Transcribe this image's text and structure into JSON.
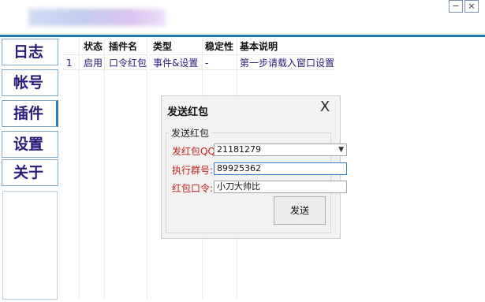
{
  "window": {
    "minimize_glyph": "−",
    "close_glyph": "×"
  },
  "sidebar": {
    "items": [
      {
        "label": "日志"
      },
      {
        "label": "帐号"
      },
      {
        "label": "插件"
      },
      {
        "label": "设置"
      },
      {
        "label": "关于"
      }
    ],
    "active_index": 2
  },
  "grid": {
    "columns": [
      "状态",
      "插件名",
      "类型",
      "稳定性",
      "基本说明"
    ],
    "rows": [
      {
        "index": "1",
        "status": "启用",
        "name": "口令红包",
        "type": "事件&设置",
        "stability": "-",
        "description": "第一步请载入窗口设置"
      }
    ]
  },
  "dialog": {
    "title": "发送红包",
    "close_glyph": "X",
    "group_label": "发送红包",
    "fields": {
      "qq_label": "发红包QQ:",
      "qq_value": "21181279",
      "group_label": "执行群号:",
      "group_value": "89925362",
      "command_label": "红包口令:",
      "command_value": "小刀大帅比"
    },
    "send_label": "发送"
  }
}
